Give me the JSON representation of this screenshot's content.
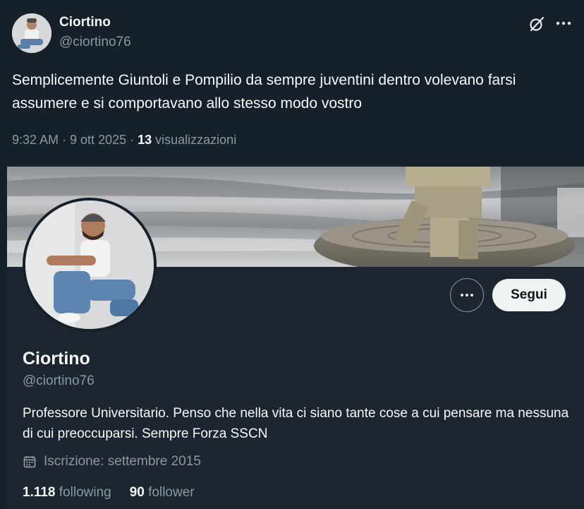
{
  "tweet": {
    "author_name": "Ciortino",
    "author_handle": "@ciortino76",
    "text": "Semplicemente Giuntoli e Pompilio da sempre juventini dentro volevano farsi assumere e si comportavano allo stesso modo vostro",
    "timestamp": "9:32 AM · 9 ott 2025 · ",
    "views_count": "13",
    "views_label": " visualizzazioni"
  },
  "profile_card": {
    "name": "Ciortino",
    "handle": "@ciortino76",
    "follow_label": "Segui",
    "bio": "Professore Universitario. Penso che nella vita ci siano tante cose a cui pensare ma nessuna di cui preoccuparsi. Sempre Forza SSCN",
    "joined": "Iscrizione: settembre 2015",
    "following_count": "1.118",
    "following_label": " following",
    "followers_count": "90",
    "followers_label": " follower"
  },
  "icons": {
    "grok": "grok-icon",
    "more": "more-horizontal-icon",
    "calendar": "calendar-icon"
  },
  "colors": {
    "background": "#15202b",
    "card_background": "#1c2530",
    "secondary_text": "#8b98a5",
    "primary_text": "#f7f9f9",
    "follow_button_bg": "#eff3f4"
  }
}
